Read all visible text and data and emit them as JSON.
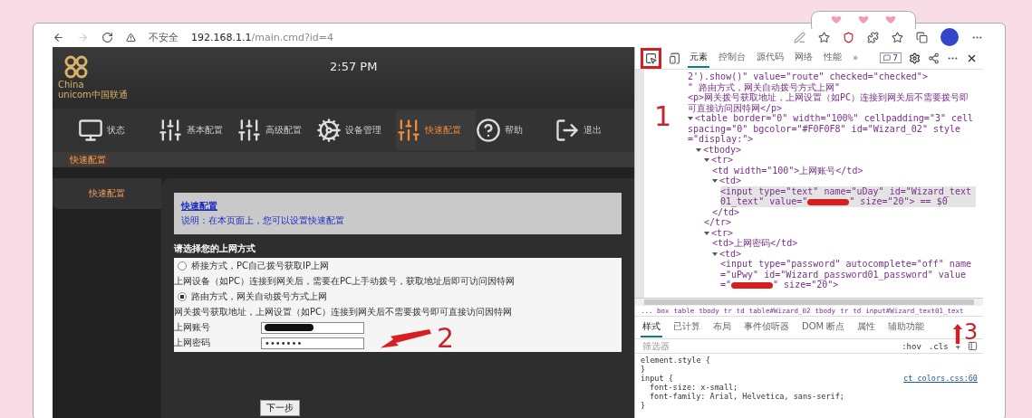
{
  "browser": {
    "security_label": "不安全",
    "url_host": "192.168.1.1",
    "url_path": "/main.cmd?id=4"
  },
  "router": {
    "logo": {
      "line1": "China",
      "line2": "unicom中国联通"
    },
    "time": "2:57 PM",
    "nav": [
      {
        "label": "状态",
        "kind": "monitor",
        "selected": false
      },
      {
        "label": "基本配置",
        "kind": "sliders",
        "selected": false
      },
      {
        "label": "高级配置",
        "kind": "sliders",
        "selected": false
      },
      {
        "label": "设备管理",
        "kind": "gears",
        "selected": false
      },
      {
        "label": "快速配置",
        "kind": "sliders",
        "selected": true
      },
      {
        "label": "帮助",
        "kind": "help",
        "selected": false
      },
      {
        "label": "退出",
        "kind": "exit",
        "selected": false
      }
    ],
    "breadcrumb": "快速配置",
    "sidebar": [
      {
        "label": "快速配置",
        "selected": true
      }
    ],
    "panel": {
      "title": "快速配置",
      "description": "说明：在本页面上，您可以设置快速配置",
      "heading": "请选择您的上网方式",
      "options": [
        {
          "label": "桥接方式，PC自己拨号获取IP上网",
          "description": "上网设备（如PC）连接到网关后，需要在PC上手动拨号，获取地址后即可访问因特网",
          "selected": false
        },
        {
          "label": "路由方式，网关自动拨号方式上网",
          "description": "网关拨号获取地址，上网设置（如PC）连接到网关后不需要拨号即可直接访问因特网",
          "selected": true
        }
      ],
      "fields": [
        {
          "label": "上网账号",
          "kind": "redacted"
        },
        {
          "label": "上网密码",
          "kind": "password",
          "value": "•••••••"
        }
      ],
      "next_button": "下一步"
    }
  },
  "devtools": {
    "tabs": [
      {
        "label": "元素",
        "selected": true
      },
      {
        "label": "控制台",
        "selected": false
      },
      {
        "label": "源代码",
        "selected": false
      },
      {
        "label": "网络",
        "selected": false
      },
      {
        "label": "性能",
        "selected": false
      }
    ],
    "more": "»",
    "issues_count": "7",
    "dom": [
      {
        "kind": "text",
        "text": "2').show()\" value=\"route\" checked=\"checked\">"
      },
      {
        "kind": "text",
        "text": "\" 路由方式，网关自动拨号方式上网\""
      },
      {
        "kind": "text",
        "text": "<p>网关拨号获取地址，上网设置（如PC）连接到网关后不需要拨号即可直接访问因特网</p>"
      },
      {
        "kind": "element",
        "text": "<table border=\"0\" width=\"100%\" cellpadding=\"3\" cellspacing=\"0\" bgcolor=\"#F0F0F8\" id=\"Wizard_02\" style=\"display:\">",
        "expanded": true,
        "children": [
          {
            "kind": "element",
            "text": "<tbody>",
            "expanded": true,
            "children": [
              {
                "kind": "element",
                "text": "<tr>",
                "expanded": true,
                "children": [
                  {
                    "kind": "text",
                    "text": "<td width=\"100\">上网账号</td>"
                  },
                  {
                    "kind": "element",
                    "text": "<td>",
                    "expanded": true,
                    "children": [
                      {
                        "kind": "redacted",
                        "text": "<input type=\"text\" name=\"uDay\" id=\"Wizard_text01_text\" value=\"",
                        "after": "\" size=\"20\">",
                        "note": "== $0",
                        "selected": true
                      }
                    ]
                  },
                  {
                    "kind": "text",
                    "text": "</td>"
                  }
                ]
              },
              {
                "kind": "text",
                "text": "</tr>"
              },
              {
                "kind": "element",
                "text": "<tr>",
                "expanded": true,
                "children": [
                  {
                    "kind": "text",
                    "text": "<td>上网密码</td>"
                  },
                  {
                    "kind": "element",
                    "text": "<td>",
                    "expanded": true,
                    "children": [
                      {
                        "kind": "redacted",
                        "text": "<input type=\"password\" autocomplete=\"off\" name=\"uPwy\" id=\"Wizard_password01_password\" value=\"",
                        "after": "\" size=\"20\">",
                        "selected": false
                      }
                    ]
                  }
                ]
              }
            ]
          }
        ]
      }
    ],
    "breadcrumbs": [
      "... box",
      "table",
      "tbody",
      "tr",
      "td",
      "table#Wizard_02",
      "tbody",
      "tr",
      "td",
      "input#Wizard_text01_text"
    ],
    "style_tabs": [
      {
        "label": "样式",
        "selected": true
      },
      {
        "label": "已计算",
        "selected": false
      },
      {
        "label": "布局",
        "selected": false
      },
      {
        "label": "事件侦听器",
        "selected": false
      },
      {
        "label": "DOM 断点",
        "selected": false
      },
      {
        "label": "属性",
        "selected": false
      },
      {
        "label": "辅助功能",
        "selected": false
      }
    ],
    "filter_placeholder": "筛选器",
    "filter_buttons": [
      ":hov",
      ".cls",
      "+"
    ],
    "rules": [
      {
        "selector": "element.style {",
        "close": "}"
      },
      {
        "selector": "input {",
        "source": "ct_colors.css:60",
        "declarations": [
          "font-size: x-small;",
          "font-family: Arial, Helvetica, sans-serif;"
        ],
        "close": "}"
      }
    ]
  },
  "annotations": [
    "1",
    "2",
    "3"
  ]
}
